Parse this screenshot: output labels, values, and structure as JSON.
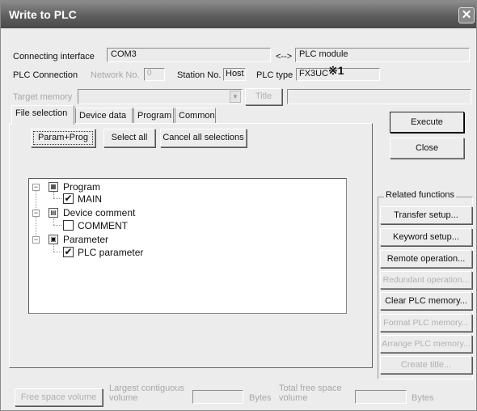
{
  "window": {
    "title": "Write to PLC",
    "close_glyph": "✕"
  },
  "conn": {
    "label": "Connecting interface",
    "value": "COM3",
    "arrow": "<-->",
    "plc_module": "PLC module",
    "plc_connection_label": "PLC Connection",
    "network_label": "Network No.",
    "network_value": "0",
    "station_label": "Station No.",
    "station_value": "Host",
    "plc_type_label": "PLC type",
    "plc_type_value": "FX3UC",
    "note_mark": "※1"
  },
  "target": {
    "label": "Target memory",
    "value": "",
    "title_btn": "Title",
    "title_value": ""
  },
  "tabs": [
    {
      "label": "File selection"
    },
    {
      "label": "Device data"
    },
    {
      "label": "Program"
    },
    {
      "label": "Common"
    }
  ],
  "selbuttons": {
    "param_prog": "Param+Prog",
    "select_all": "Select all",
    "cancel_all": "Cancel all selections"
  },
  "tree": [
    {
      "label": "Program",
      "expand": "−",
      "icon": "▦"
    },
    {
      "label": "MAIN",
      "check": "✔"
    },
    {
      "label": "Device comment",
      "expand": "−",
      "icon": "▤"
    },
    {
      "label": "COMMENT",
      "check": ""
    },
    {
      "label": "Parameter",
      "expand": "−",
      "icon": "▣"
    },
    {
      "label": "PLC parameter",
      "check": "✔"
    }
  ],
  "actions": {
    "execute": "Execute",
    "close": "Close"
  },
  "related": {
    "label": "Related functions",
    "buttons": [
      {
        "label": "Transfer setup..."
      },
      {
        "label": "Keyword setup..."
      },
      {
        "label": "Remote operation..."
      },
      {
        "label": "Redundant operation..."
      },
      {
        "label": "Clear PLC memory..."
      },
      {
        "label": "Format PLC memory..."
      },
      {
        "label": "Arrange PLC memory..."
      },
      {
        "label": "Create title..."
      }
    ]
  },
  "footer": {
    "free_space_btn": "Free space volume",
    "largest_label_1": "Largest contiguous",
    "largest_label_2": "volume",
    "largest_value": "",
    "bytes1": "Bytes",
    "total_label_1": "Total free space",
    "total_label_2": "volume",
    "total_value": "",
    "bytes2": "Bytes"
  }
}
